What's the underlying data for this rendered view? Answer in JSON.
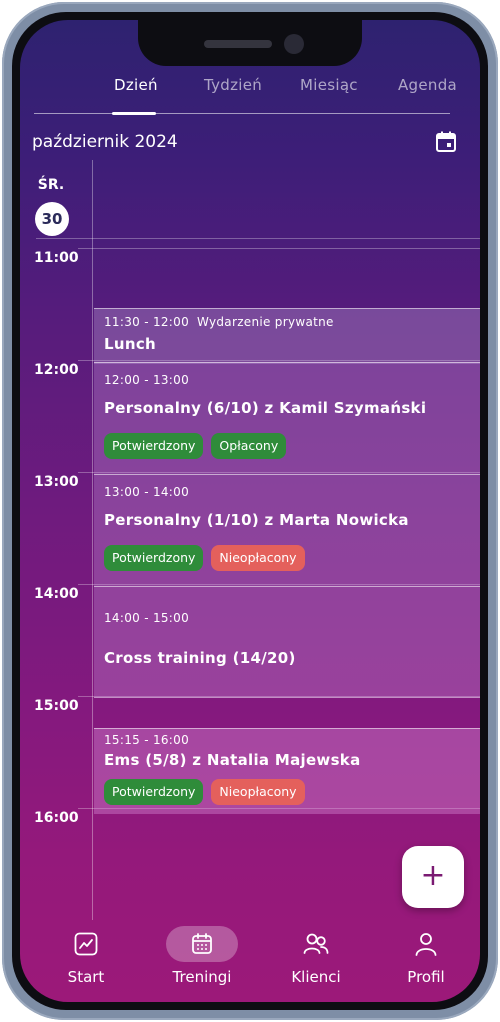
{
  "tabs": [
    {
      "label": "Dzień",
      "active": true
    },
    {
      "label": "Tydzień",
      "active": false
    },
    {
      "label": "Miesiąc",
      "active": false
    },
    {
      "label": "Agenda",
      "active": false
    }
  ],
  "calendar": {
    "month_title": "październik 2024",
    "day_label": "ŚR.",
    "day_number": "30",
    "calendar_icon": "calendar-icon"
  },
  "hours": [
    "11:00",
    "12:00",
    "13:00",
    "14:00",
    "15:00",
    "16:00"
  ],
  "events": {
    "lunch": {
      "time": "11:30 - 12:00",
      "subtitle": "Wydarzenie prywatne",
      "title": "Lunch"
    },
    "personal1": {
      "time": "12:00 - 13:00",
      "title": "Personalny (6/10) z Kamil Szymański",
      "badge1": "Potwierdzony",
      "badge2": "Opłacony"
    },
    "personal2": {
      "time": "13:00 - 14:00",
      "title": "Personalny (1/10) z Marta Nowicka",
      "badge1": "Potwierdzony",
      "badge2": "Nieopłacony"
    },
    "cross": {
      "time": "14:00 - 15:00",
      "title": "Cross training (14/20)"
    },
    "ems": {
      "time": "15:15 - 16:00",
      "title": "Ems (5/8) z Natalia Majewska",
      "badge1": "Potwierdzony",
      "badge2": "Nieopłacony"
    }
  },
  "fab": {
    "label": "+"
  },
  "nav": [
    {
      "label": "Start",
      "icon": "chart-icon"
    },
    {
      "label": "Treningi",
      "icon": "calendar-icon",
      "active": true
    },
    {
      "label": "Klienci",
      "icon": "users-icon"
    },
    {
      "label": "Profil",
      "icon": "user-icon"
    }
  ],
  "colors": {
    "accent": "#7a1a72",
    "confirmed": "#2f8c3a",
    "unpaid": "#e4605c",
    "paid": "#2f8c3a"
  }
}
